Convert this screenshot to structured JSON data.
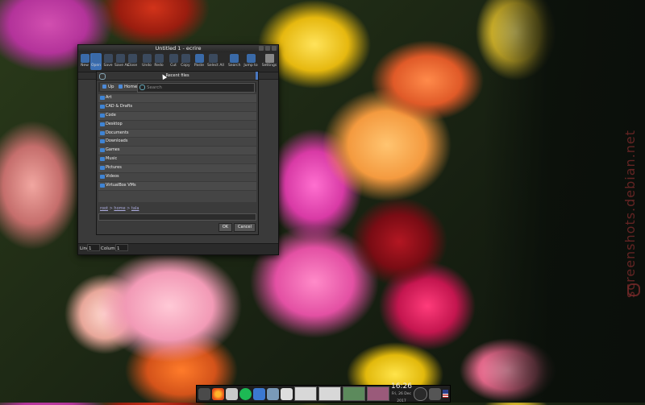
{
  "window": {
    "title": "Untitled 1 - ecrire"
  },
  "toolbar": {
    "items": [
      {
        "label": "New",
        "icon": "new-file-icon"
      },
      {
        "label": "Open",
        "icon": "open-folder-icon"
      },
      {
        "label": "Save",
        "icon": "save-icon"
      },
      {
        "label": "Save As",
        "icon": "save-as-icon"
      },
      {
        "label": "Close",
        "icon": "close-doc-icon"
      },
      {
        "label": "Undo",
        "icon": "undo-icon"
      },
      {
        "label": "Redo",
        "icon": "redo-icon"
      },
      {
        "label": "Cut",
        "icon": "cut-icon"
      },
      {
        "label": "Copy",
        "icon": "copy-icon"
      },
      {
        "label": "Paste",
        "icon": "paste-icon"
      },
      {
        "label": "Select All",
        "icon": "select-all-icon"
      },
      {
        "label": "Search",
        "icon": "search-icon"
      },
      {
        "label": "Jump to",
        "icon": "jump-icon"
      },
      {
        "label": "Settings",
        "icon": "settings-icon"
      }
    ]
  },
  "dialog": {
    "header": "Recent files",
    "nav": {
      "up_label": "Up",
      "home_label": "Home",
      "search_placeholder": "Search"
    },
    "folders": [
      "Art",
      "CAD & Drafts",
      "Code",
      "Desktop",
      "Documents",
      "Downloads",
      "Games",
      "Music",
      "Pictures",
      "Videos",
      "VirtualBox VMs"
    ],
    "path": [
      "root",
      "home",
      "tala"
    ],
    "ok_label": "OK",
    "cancel_label": "Cancel"
  },
  "status": {
    "line_label": "Line",
    "line_value": "1",
    "column_label": "Column",
    "column_value": "1"
  },
  "taskbar": {
    "time": "16:26",
    "date": "Fri, 26 Dec 2017"
  },
  "watermark": "screenshots.debian.net"
}
